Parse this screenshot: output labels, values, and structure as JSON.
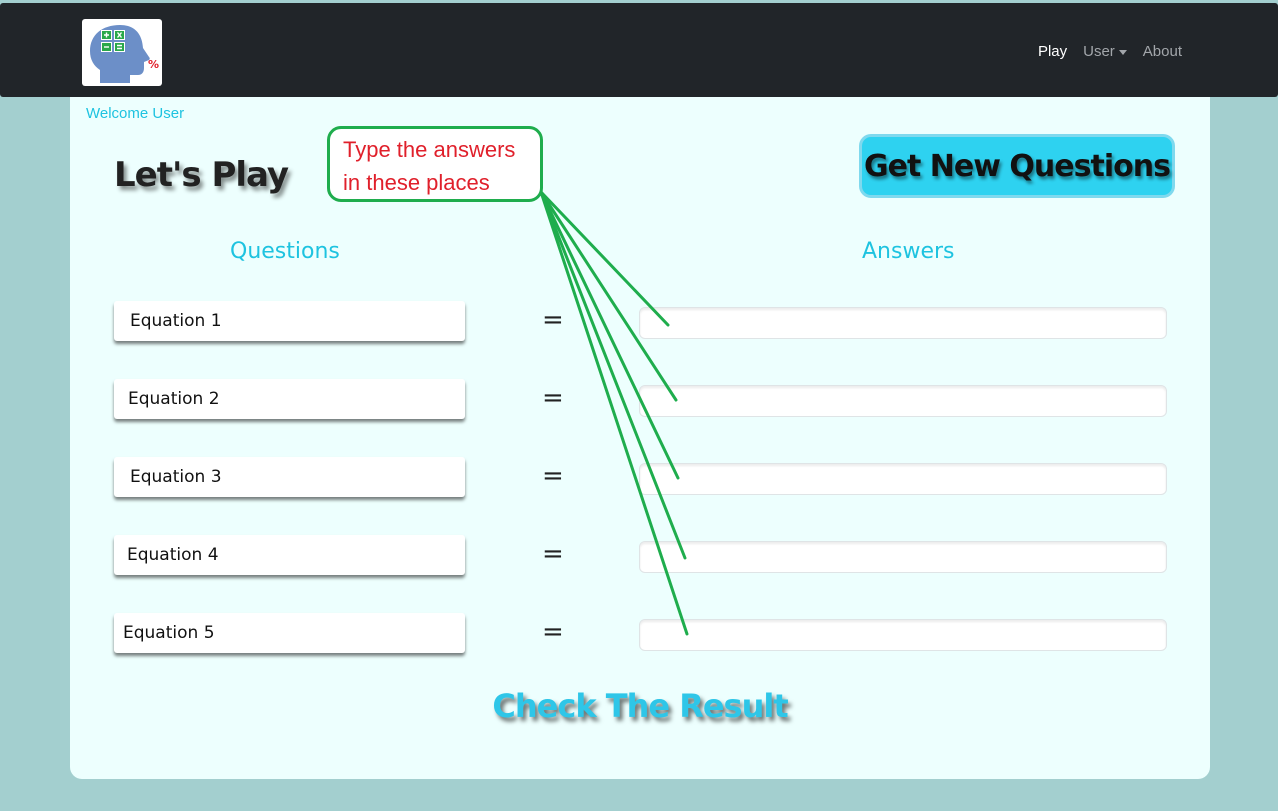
{
  "nav": {
    "logo_badge": "%",
    "links": [
      {
        "label": "Play"
      },
      {
        "label": "User"
      },
      {
        "label": "About"
      }
    ]
  },
  "main": {
    "welcome": "Welcome User",
    "heading": "Let's Play",
    "new_questions_label": "Get New Questions",
    "questions_header": "Questions",
    "answers_header": "Answers",
    "equal_sign": "=",
    "rows": [
      {
        "question": "Equation 1",
        "answer": ""
      },
      {
        "question": "Equation 2",
        "answer": ""
      },
      {
        "question": "Equation 3",
        "answer": ""
      },
      {
        "question": "Equation 4",
        "answer": ""
      },
      {
        "question": "Equation 5",
        "answer": ""
      }
    ],
    "check_label": "Check The Result"
  },
  "annotation": {
    "line1": "Type the answers",
    "line2": "in these places",
    "color": "#1fad4d",
    "text_color": "#e0202b"
  },
  "colors": {
    "accent": "#1ec3e0",
    "navbar": "#212529",
    "page_bg": "#a3cfcf",
    "card_bg": "#edfffe"
  }
}
